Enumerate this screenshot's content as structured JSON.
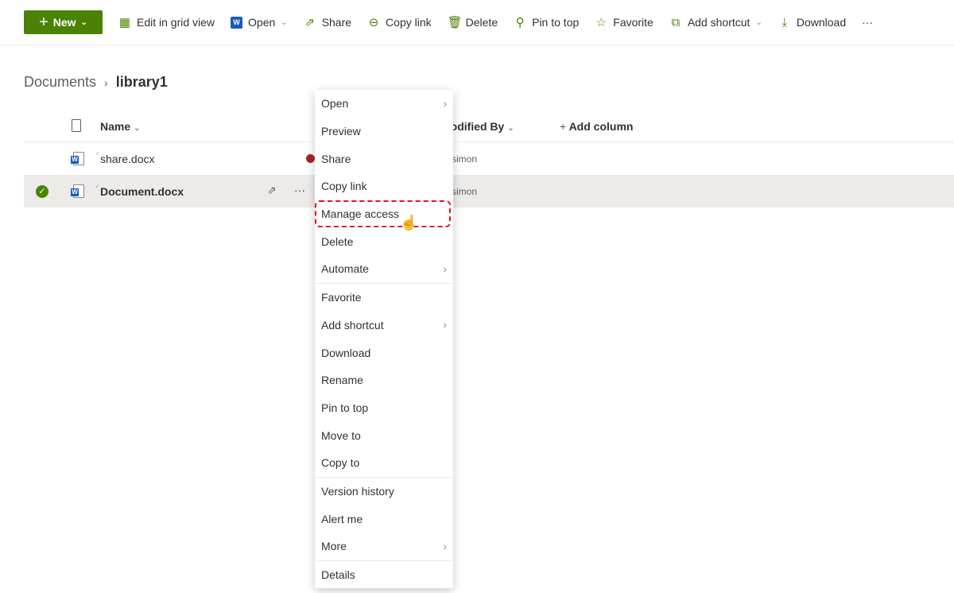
{
  "toolbar": {
    "new": "New",
    "items": [
      {
        "label": "Edit in grid view",
        "icon": "grid-icon"
      },
      {
        "label": "Open",
        "icon": "word-icon"
      },
      {
        "label": "Share",
        "icon": "share-icon"
      },
      {
        "label": "Copy link",
        "icon": "link-icon"
      },
      {
        "label": "Delete",
        "icon": "trash-icon"
      },
      {
        "label": "Pin to top",
        "icon": "pin-icon"
      },
      {
        "label": "Favorite",
        "icon": "star-icon"
      },
      {
        "label": "Add shortcut",
        "icon": "shortcut-icon"
      },
      {
        "label": "Download",
        "icon": "download-icon"
      }
    ],
    "more": "···"
  },
  "breadcrumb": {
    "parent": "Documents",
    "current": "library1"
  },
  "columns": {
    "name": "Name",
    "modified_by": "Modified By",
    "add": "Add column"
  },
  "files": [
    {
      "name": "share.docx",
      "modified_by": "simon"
    },
    {
      "name": "Document.docx",
      "modified_by": "simon"
    }
  ],
  "row_more": "···",
  "menu": {
    "items": [
      "Open",
      "Preview",
      "Share",
      "Copy link",
      "Manage access",
      "Delete",
      "Automate",
      "Favorite",
      "Add shortcut",
      "Download",
      "Rename",
      "Pin to top",
      "Move to",
      "Copy to",
      "Version history",
      "Alert me",
      "More",
      "Details"
    ]
  },
  "colors": {
    "accent": "#498205",
    "highlight": "#e81123",
    "selected_row": "#edebe9"
  }
}
